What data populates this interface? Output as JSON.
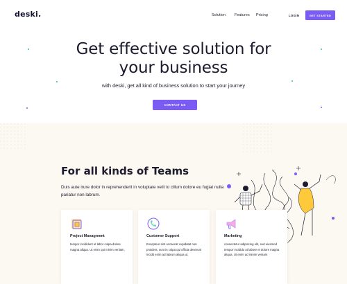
{
  "nav": {
    "logo": "deski.",
    "links": [
      "Solution",
      "Features",
      "Pricing"
    ],
    "login": "LOGIN",
    "get_started": "GET STARTED"
  },
  "hero": {
    "title_line1": "Get effective solution for",
    "title_line2": "your business",
    "subtitle": "with deski, get all kind of business solution to start your journey",
    "cta": "CONTACT US"
  },
  "teams": {
    "title": "For all kinds of Teams",
    "description": "Duis aute irure dolor in reprehenderit in voluptate velit io cillum dolore eu fugiat nulla pariatur non labrum."
  },
  "cards": [
    {
      "icon": "project-management-icon",
      "title": "Project Managment",
      "text": "tempor incididunt ut labor culpa dolore magna aliqua. Ut enim qui minim veniam,"
    },
    {
      "icon": "phone-support-icon",
      "title": "Customer Support",
      "text": "Excepteur sint occaecat cupidatat non proident, sunt in culpa qui officia deserunt incidit enim ad labrum aliqua ut."
    },
    {
      "icon": "megaphone-icon",
      "title": "Marketing",
      "text": "consectetur adipiscing elit, sed eiusmod tempor incididu ut labore et dolore magna aliqua. Ut enim ad minim veniam"
    }
  ],
  "colors": {
    "accent": "#7a5cf5",
    "section_bg": "#fcf8f2",
    "text": "#1c1c2e",
    "yellow": "#ffc93c",
    "teal": "#2ec4a6"
  }
}
